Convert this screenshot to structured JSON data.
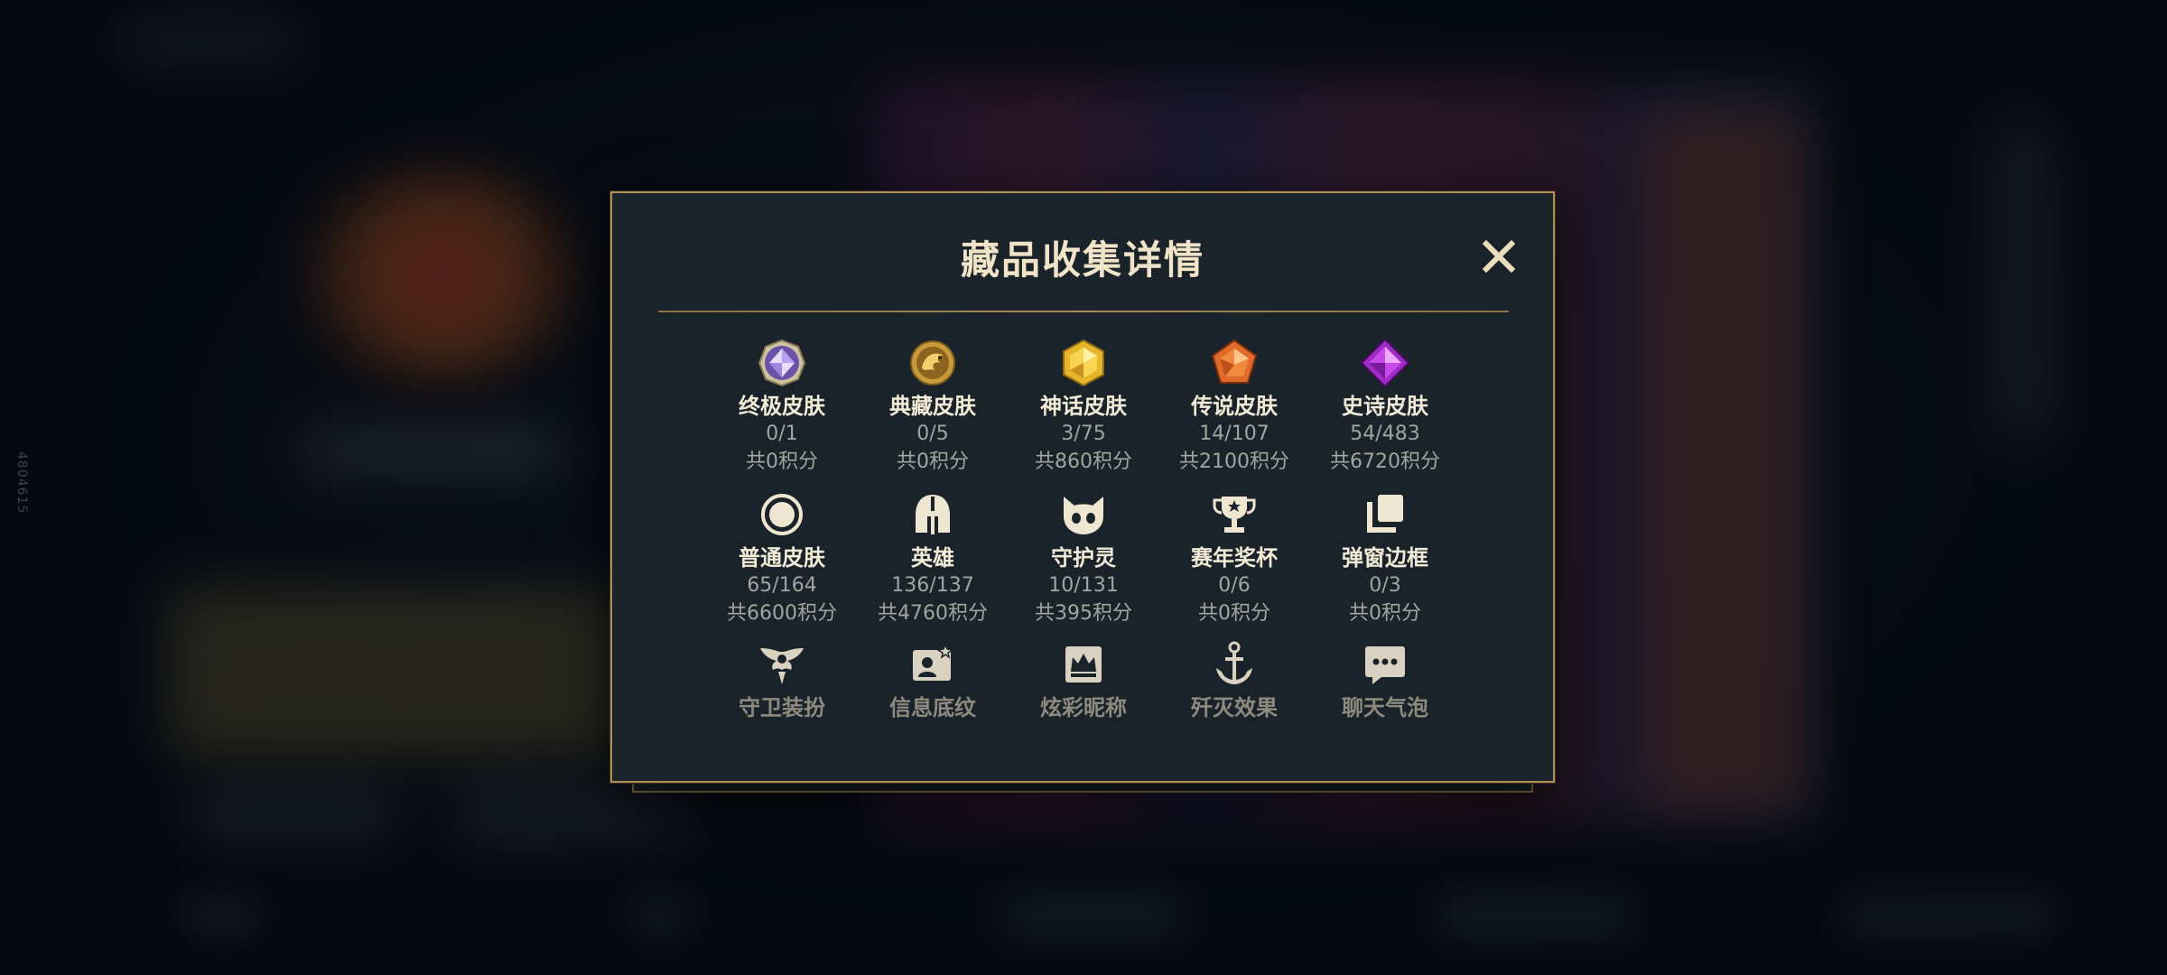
{
  "background": {
    "side_id": "4804615"
  },
  "dialog": {
    "title": "藏品收集详情",
    "close_icon": "close-icon"
  },
  "items": [
    {
      "icon": "ultimate-skin-gem-icon",
      "name": "终极皮肤",
      "count": "0/1",
      "points": "共0积分"
    },
    {
      "icon": "prestige-skin-dragon-icon",
      "name": "典藏皮肤",
      "count": "0/5",
      "points": "共0积分"
    },
    {
      "icon": "mythic-skin-gem-icon",
      "name": "神话皮肤",
      "count": "3/75",
      "points": "共860积分"
    },
    {
      "icon": "legendary-skin-gem-icon",
      "name": "传说皮肤",
      "count": "14/107",
      "points": "共2100积分"
    },
    {
      "icon": "epic-skin-gem-icon",
      "name": "史诗皮肤",
      "count": "54/483",
      "points": "共6720积分"
    },
    {
      "icon": "standard-skin-circle-icon",
      "name": "普通皮肤",
      "count": "65/164",
      "points": "共6600积分"
    },
    {
      "icon": "champion-helmet-icon",
      "name": "英雄",
      "count": "136/137",
      "points": "共4760积分"
    },
    {
      "icon": "little-legend-icon",
      "name": "守护灵",
      "count": "10/131",
      "points": "共395积分"
    },
    {
      "icon": "trophy-icon",
      "name": "赛年奖杯",
      "count": "0/6",
      "points": "共0积分"
    },
    {
      "icon": "frame-stack-icon",
      "name": "弹窗边框",
      "count": "0/3",
      "points": "共0积分"
    },
    {
      "icon": "guardian-wings-icon",
      "name": "守卫装扮"
    },
    {
      "icon": "profile-banner-icon",
      "name": "信息底纹"
    },
    {
      "icon": "crown-nameplate-icon",
      "name": "炫彩昵称"
    },
    {
      "icon": "finisher-anchor-icon",
      "name": "歼灭效果"
    },
    {
      "icon": "chat-bubble-icon",
      "name": "聊天气泡"
    }
  ],
  "colors": {
    "dialog_bg": "#1a2329",
    "gold_border": "#b08e57",
    "title_text": "#f0e3c8",
    "sub_text": "#a3a49f"
  }
}
